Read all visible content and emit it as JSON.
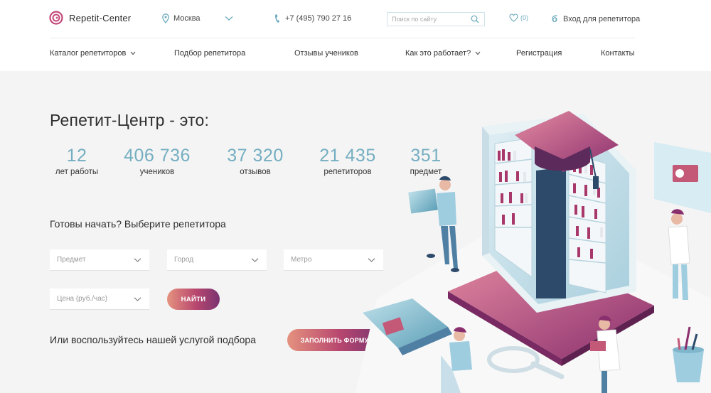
{
  "header": {
    "logo_text": "Repetit-Center",
    "city": "Москва",
    "phone": "+7 (495) 790 27 16",
    "search_placeholder": "Поиск по сайту",
    "favorites_count": "(0)",
    "login_icon_glyph": "б",
    "login_label": "Вход для репетитора"
  },
  "nav": {
    "items": [
      {
        "label": "Каталог репетиторов",
        "has_dropdown": true
      },
      {
        "label": "Подбор репетитора",
        "has_dropdown": false
      },
      {
        "label": "Отзывы учеников",
        "has_dropdown": false
      },
      {
        "label": "Как это работает?",
        "has_dropdown": true
      },
      {
        "label": "Регистрация",
        "has_dropdown": false
      },
      {
        "label": "Контакты",
        "has_dropdown": false
      }
    ]
  },
  "hero": {
    "title": "Репетит-Центр - это:",
    "stats": [
      {
        "value": "12",
        "label": "лет работы"
      },
      {
        "value": "406 736",
        "label": "учеников"
      },
      {
        "value": "37 320",
        "label": "отзывов"
      },
      {
        "value": "21 435",
        "label": "репетиторов"
      },
      {
        "value": "351",
        "label": "предмет"
      }
    ]
  },
  "filters": {
    "heading": "Готовы начать? Выберите репетитора",
    "subject_placeholder": "Предмет",
    "city_placeholder": "Город",
    "metro_placeholder": "Метро",
    "price_placeholder": "Цена (руб./час)",
    "find_label": "НАЙТИ"
  },
  "service": {
    "text": "Или воспользуйтесь нашей услугой подбора",
    "button_label": "ЗАПОЛНИТЬ ФОРМУ"
  },
  "colors": {
    "accent_blue": "#74aec1",
    "gradient_start": "#e5927f",
    "gradient_mid": "#b8476f",
    "gradient_end": "#7a3471"
  }
}
